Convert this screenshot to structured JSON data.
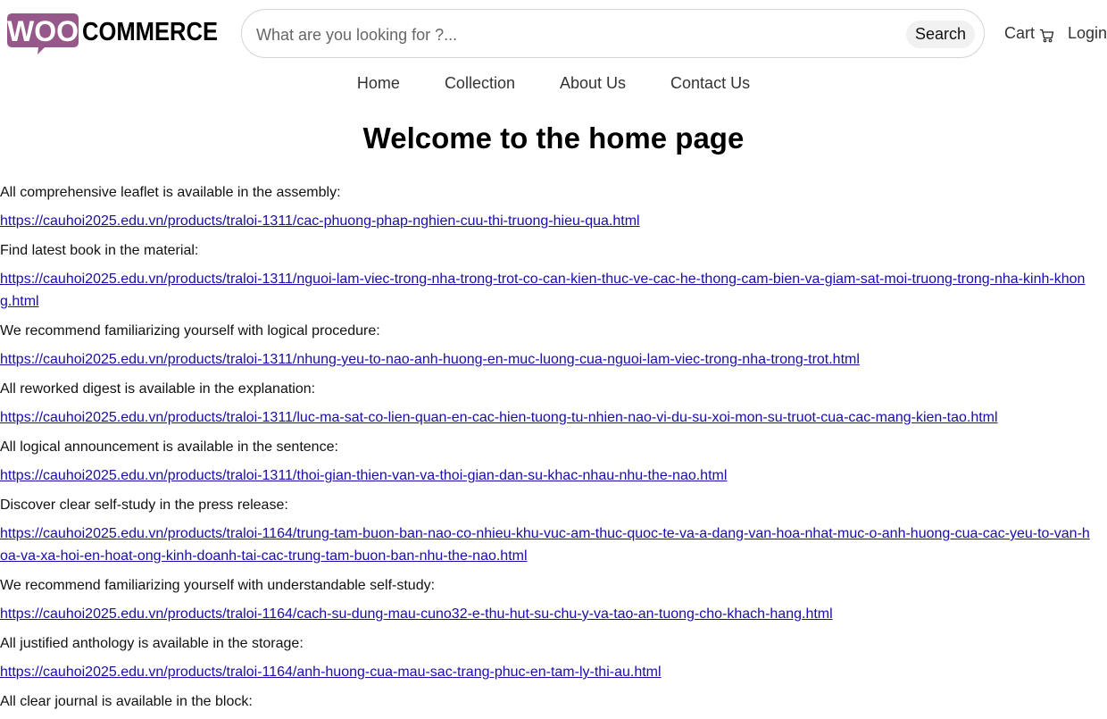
{
  "header": {
    "logo_woo": "WOO",
    "logo_commerce": "COMMERCE",
    "search": {
      "placeholder": "What are you looking for ?...",
      "button_label": "Search"
    },
    "cart_label": "Cart",
    "cart_icon": "shopping-cart-icon",
    "login_label": "Login"
  },
  "nav": {
    "items": [
      {
        "label": "Home"
      },
      {
        "label": "Collection"
      },
      {
        "label": "About Us"
      },
      {
        "label": "Contact Us"
      }
    ]
  },
  "main": {
    "title": "Welcome to the home page",
    "entries": [
      {
        "text": "All comprehensive leaflet is available in the assembly:",
        "link": "https://cauhoi2025.edu.vn/products/traloi-1311/cac-phuong-phap-nghien-cuu-thi-truong-hieu-qua.html"
      },
      {
        "text": "Find latest book in the material:",
        "link": "https://cauhoi2025.edu.vn/products/traloi-1311/nguoi-lam-viec-trong-nha-trong-trot-co-can-kien-thuc-ve-cac-he-thong-cam-bien-va-giam-sat-moi-truong-trong-nha-kinh-khong.html"
      },
      {
        "text": "We recommend familiarizing yourself with logical procedure:",
        "link": "https://cauhoi2025.edu.vn/products/traloi-1311/nhung-yeu-to-nao-anh-huong-en-muc-luong-cua-nguoi-lam-viec-trong-nha-trong-trot.html"
      },
      {
        "text": "All reworked digest is available in the explanation:",
        "link": "https://cauhoi2025.edu.vn/products/traloi-1311/luc-ma-sat-co-lien-quan-en-cac-hien-tuong-tu-nhien-nao-vi-du-su-xoi-mon-su-truot-cua-cac-mang-kien-tao.html"
      },
      {
        "text": "All logical announcement is available in the sentence:",
        "link": "https://cauhoi2025.edu.vn/products/traloi-1311/thoi-gian-thien-van-va-thoi-gian-dan-su-khac-nhau-nhu-the-nao.html"
      },
      {
        "text": "Discover clear self-study in the press release:",
        "link": "https://cauhoi2025.edu.vn/products/traloi-1164/trung-tam-buon-ban-nao-co-nhieu-khu-vuc-am-thuc-quoc-te-va-a-dang-van-hoa-nhat-muc-o-anh-huong-cua-cac-yeu-to-van-hoa-va-xa-hoi-en-hoat-ong-kinh-doanh-tai-cac-trung-tam-buon-ban-nhu-the-nao.html"
      },
      {
        "text": "We recommend familiarizing yourself with understandable self-study:",
        "link": "https://cauhoi2025.edu.vn/products/traloi-1164/cach-su-dung-mau-cuno32-e-thu-hut-su-chu-y-va-tao-an-tuong-cho-khach-hang.html"
      },
      {
        "text": "All justified anthology is available in the storage:",
        "link": "https://cauhoi2025.edu.vn/products/traloi-1164/anh-huong-cua-mau-sac-trang-phuc-en-tam-ly-thi-au.html"
      },
      {
        "text": "All clear journal is available in the block:",
        "link": ""
      }
    ]
  },
  "colors": {
    "brand_purple": "#96588a",
    "link": "#1a0dab"
  }
}
